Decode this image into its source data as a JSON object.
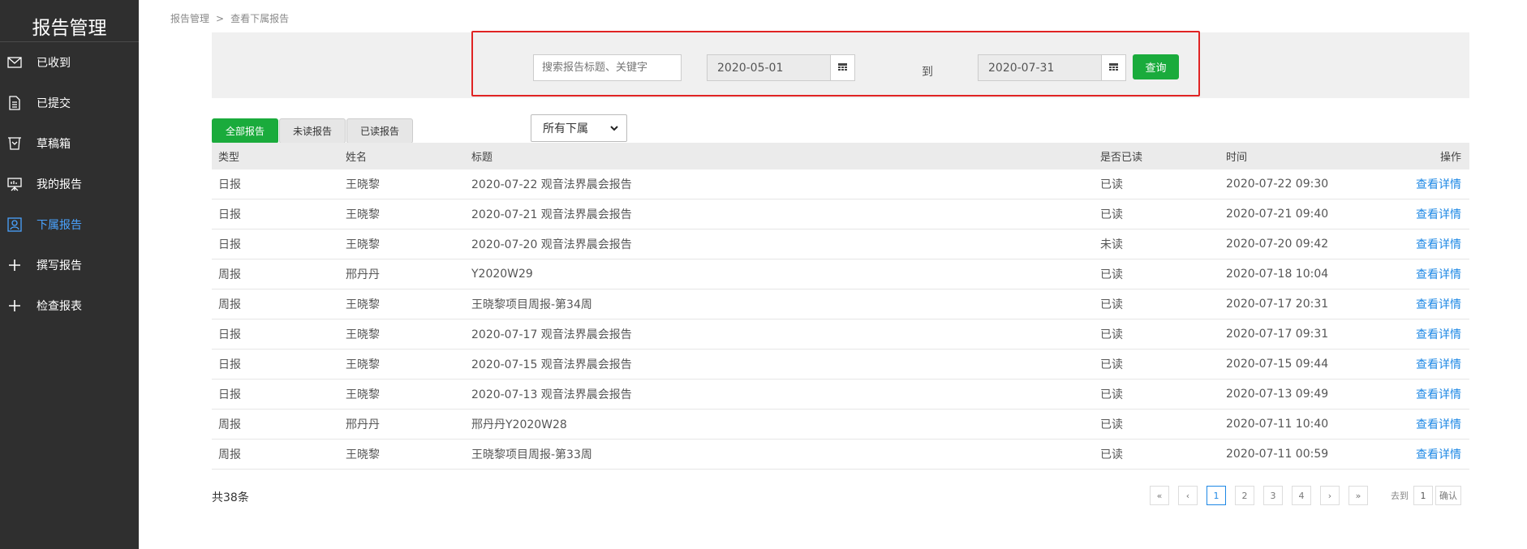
{
  "sidebar": {
    "title": "报告管理",
    "items": [
      {
        "label": "已收到",
        "icon": "envelope-icon"
      },
      {
        "label": "已提交",
        "icon": "document-icon"
      },
      {
        "label": "草稿箱",
        "icon": "drafts-icon"
      },
      {
        "label": "我的报告",
        "icon": "presentation-icon"
      },
      {
        "label": "下属报告",
        "icon": "subordinate-icon",
        "active": true
      },
      {
        "label": "撰写报告",
        "icon": "plus-icon"
      },
      {
        "label": "检查报表",
        "icon": "plus-icon"
      }
    ]
  },
  "breadcrumb": {
    "root": "报告管理",
    "sep": ">",
    "current": "查看下属报告"
  },
  "filter": {
    "search_placeholder": "搜索报告标题、关键字",
    "start_date": "2020-05-01",
    "to_label": "到",
    "end_date": "2020-07-31",
    "query_label": "查询"
  },
  "tabs": [
    "全部报告",
    "未读报告",
    "已读报告"
  ],
  "subordinate_select": "所有下属",
  "table": {
    "headers": [
      "类型",
      "姓名",
      "标题",
      "是否已读",
      "时间",
      "操作"
    ],
    "rows": [
      [
        "日报",
        "王晓黎",
        "2020-07-22 观音法界晨会报告",
        "已读",
        "2020-07-22 09:30",
        "查看详情"
      ],
      [
        "日报",
        "王晓黎",
        "2020-07-21 观音法界晨会报告",
        "已读",
        "2020-07-21 09:40",
        "查看详情"
      ],
      [
        "日报",
        "王晓黎",
        "2020-07-20 观音法界晨会报告",
        "未读",
        "2020-07-20 09:42",
        "查看详情"
      ],
      [
        "周报",
        "邢丹丹",
        "Y2020W29",
        "已读",
        "2020-07-18 10:04",
        "查看详情"
      ],
      [
        "周报",
        "王晓黎",
        "王晓黎项目周报-第34周",
        "已读",
        "2020-07-17 20:31",
        "查看详情"
      ],
      [
        "日报",
        "王晓黎",
        "2020-07-17 观音法界晨会报告",
        "已读",
        "2020-07-17 09:31",
        "查看详情"
      ],
      [
        "日报",
        "王晓黎",
        "2020-07-15 观音法界晨会报告",
        "已读",
        "2020-07-15 09:44",
        "查看详情"
      ],
      [
        "日报",
        "王晓黎",
        "2020-07-13 观音法界晨会报告",
        "已读",
        "2020-07-13 09:49",
        "查看详情"
      ],
      [
        "周报",
        "邢丹丹",
        "邢丹丹Y2020W28",
        "已读",
        "2020-07-11 10:40",
        "查看详情"
      ],
      [
        "周报",
        "王晓黎",
        "王晓黎项目周报-第33周",
        "已读",
        "2020-07-11 00:59",
        "查看详情"
      ]
    ]
  },
  "footer": {
    "total": "共38条",
    "pages": [
      "«",
      "‹",
      "1",
      "2",
      "3",
      "4",
      "›",
      "»"
    ],
    "current_page": "1",
    "goto_label": "去到",
    "goto_value": "1",
    "confirm_label": "确认"
  }
}
